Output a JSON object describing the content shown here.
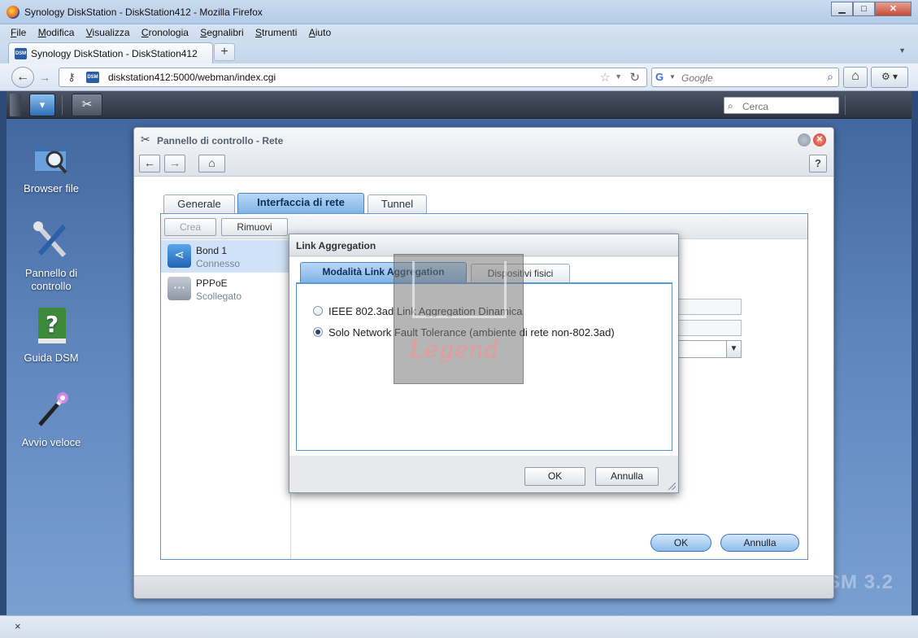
{
  "browser": {
    "window_title": "Synology DiskStation - DiskStation412 - Mozilla Firefox",
    "menu": [
      "File",
      "Modifica",
      "Visualizza",
      "Cronologia",
      "Segnalibri",
      "Strumenti",
      "Aiuto"
    ],
    "tab_title": "Synology DiskStation - DiskStation412",
    "favicon_text": "DSM",
    "url": "diskstation412:5000/webman/index.cgi",
    "search_placeholder": "Google",
    "statusbar_close": "×",
    "window_buttons": {
      "minimize": "▁",
      "maximize": "□",
      "close": "✕"
    }
  },
  "dsm": {
    "search_placeholder": "Cerca",
    "version_watermark": "SM 3.2",
    "desktop_icons": [
      {
        "label": "Browser file",
        "icon": "folder-search-icon"
      },
      {
        "label": "Pannello di controllo",
        "icon": "tools-icon"
      },
      {
        "label": "Guida DSM",
        "icon": "help-book-icon"
      },
      {
        "label": "Avvio veloce",
        "icon": "magic-wand-icon"
      }
    ]
  },
  "control_panel": {
    "title": "Pannello di controllo - Rete",
    "tabs": [
      "Generale",
      "Interfaccia di rete",
      "Tunnel"
    ],
    "active_tab": "Interfaccia di rete",
    "toolbar": {
      "create": "Crea",
      "remove": "Rimuovi"
    },
    "interfaces": [
      {
        "name": "Bond 1",
        "status": "Connesso",
        "selected": true
      },
      {
        "name": "PPPoE",
        "status": "Scollegato",
        "selected": false
      }
    ],
    "ok": "OK",
    "cancel": "Annulla",
    "help": "?"
  },
  "modal": {
    "title": "Link Aggregation",
    "tabs": [
      "Modalità Link Aggregation",
      "Dispositivi fisici"
    ],
    "active_tab": "Modalità Link Aggregation",
    "options": [
      {
        "label": "IEEE 802.3ad Link Aggregation Dinamica",
        "selected": false
      },
      {
        "label": "Solo Network Fault Tolerance (ambiente di rete non-802.3ad)",
        "selected": true
      }
    ],
    "ok": "OK",
    "cancel": "Annulla"
  },
  "watermark": {
    "text": "Legend"
  },
  "colors": {
    "accent": "#7fb3e6",
    "desktop": "#5e86bd",
    "taskbar": "#2d3340"
  }
}
